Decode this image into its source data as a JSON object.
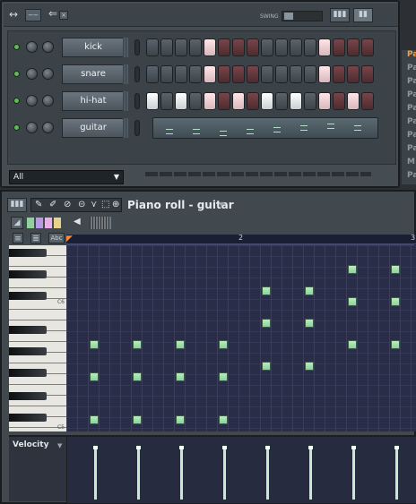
{
  "channel_rack": {
    "swing_label": "SWING",
    "channels": [
      {
        "name": "kick",
        "steps": [
          0,
          0,
          0,
          0,
          1,
          0,
          0,
          0,
          0,
          0,
          0,
          0,
          1,
          0,
          0,
          0
        ]
      },
      {
        "name": "snare",
        "steps": [
          0,
          0,
          0,
          0,
          1,
          0,
          0,
          0,
          0,
          0,
          0,
          0,
          1,
          0,
          0,
          0
        ]
      },
      {
        "name": "hi-hat",
        "steps": [
          1,
          0,
          1,
          0,
          1,
          0,
          1,
          0,
          1,
          0,
          1,
          0,
          1,
          0,
          1,
          0
        ]
      },
      {
        "name": "guitar",
        "steps": []
      }
    ],
    "filter_value": "All"
  },
  "piano_roll": {
    "title": "Piano roll - guitar",
    "bar_markers": [
      "2",
      "3"
    ],
    "key_labels": [
      "C6",
      "C5"
    ],
    "velocity_label": "Velocity",
    "scale_button": "Abc"
  },
  "side_list": {
    "items": [
      "Pa",
      "Pa",
      "Pa",
      "Pa",
      "Pa",
      "Pa",
      "Pa",
      "Pa",
      "M",
      "Pa"
    ]
  },
  "colors": {
    "note": "#a8e6b4",
    "grid": "#2a2d47",
    "step_on": "#ffffff",
    "step_alt": "#77454a",
    "led": "#5cbf4a"
  },
  "icons": [
    "arrows-icon",
    "back-icon",
    "swing-slider-icon",
    "graph-icon",
    "piano-icon",
    "pencil-icon",
    "brush-icon",
    "delete-icon",
    "mute-icon",
    "slice-icon",
    "select-icon",
    "zoom-icon"
  ]
}
